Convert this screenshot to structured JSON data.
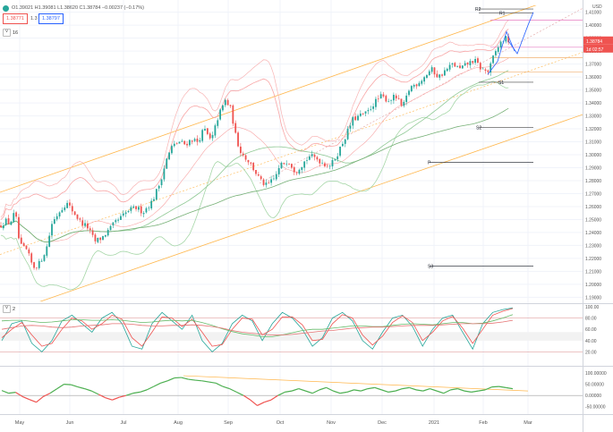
{
  "header": {
    "ohlc": "O1.39021 H1.39081 L1.38620 C1.38784 −0.00237 (−0.17%)",
    "sell_price": "1.38771",
    "lot_size": "1.3",
    "buy_price": "1.38797",
    "indicator_label": "16",
    "osc_label": "2"
  },
  "colors": {
    "up": "#26a69a",
    "down": "#ef5350",
    "bollinger": "#f8a5a5",
    "ma_fast": "#90c995",
    "ma_slow": "#76b076",
    "channel": "#ffb74d",
    "pitchfork": "#2962ff",
    "pivot": "#131722",
    "stoch_k": "#26a69a",
    "stoch_d": "#ef5350",
    "osc_line": "#4caf50",
    "osc_neg": "#ef5350"
  },
  "chart_data": [
    {
      "type": "candlestick",
      "title": "",
      "ylabel": "USD",
      "x_tick_labels": [
        "May",
        "Jun",
        "Jul",
        "Aug",
        "Sep",
        "Oct",
        "Nov",
        "Dec",
        "2021",
        "Feb",
        "Mar"
      ],
      "ylim": [
        1.1868,
        1.4153
      ],
      "y_tick_labels": [
        "1.41000",
        "1.40000",
        "1.39000",
        "1.38000",
        "1.37000",
        "1.36000",
        "1.35000",
        "1.34000",
        "1.33000",
        "1.32000",
        "1.31000",
        "1.30000",
        "1.29000",
        "1.28000",
        "1.27000",
        "1.26000",
        "1.25000",
        "1.24000",
        "1.23000",
        "1.22000",
        "1.21000",
        "1.20000",
        "1.19000"
      ],
      "close_path": [
        [
          0,
          1.245
        ],
        [
          6,
          1.249
        ],
        [
          11,
          1.247
        ],
        [
          17,
          1.256
        ],
        [
          22,
          1.23
        ],
        [
          30,
          1.226
        ],
        [
          37,
          1.213
        ],
        [
          44,
          1.216
        ],
        [
          52,
          1.228
        ],
        [
          58,
          1.247
        ],
        [
          66,
          1.256
        ],
        [
          74,
          1.263
        ],
        [
          82,
          1.256
        ],
        [
          90,
          1.248
        ],
        [
          98,
          1.244
        ],
        [
          106,
          1.233
        ],
        [
          114,
          1.236
        ],
        [
          122,
          1.242
        ],
        [
          128,
          1.247
        ],
        [
          136,
          1.252
        ],
        [
          144,
          1.257
        ],
        [
          152,
          1.259
        ],
        [
          160,
          1.256
        ],
        [
          170,
          1.264
        ],
        [
          178,
          1.277
        ],
        [
          186,
          1.296
        ],
        [
          192,
          1.306
        ],
        [
          200,
          1.31
        ],
        [
          207,
          1.308
        ],
        [
          214,
          1.312
        ],
        [
          221,
          1.31
        ],
        [
          228,
          1.32
        ],
        [
          236,
          1.31
        ],
        [
          244,
          1.33
        ],
        [
          252,
          1.342
        ],
        [
          258,
          1.335
        ],
        [
          264,
          1.312
        ],
        [
          270,
          1.301
        ],
        [
          278,
          1.295
        ],
        [
          286,
          1.286
        ],
        [
          292,
          1.279
        ],
        [
          298,
          1.276
        ],
        [
          306,
          1.281
        ],
        [
          314,
          1.292
        ],
        [
          322,
          1.296
        ],
        [
          330,
          1.287
        ],
        [
          338,
          1.293
        ],
        [
          346,
          1.299
        ],
        [
          354,
          1.297
        ],
        [
          362,
          1.293
        ],
        [
          370,
          1.292
        ],
        [
          378,
          1.302
        ],
        [
          386,
          1.314
        ],
        [
          394,
          1.327
        ],
        [
          402,
          1.33
        ],
        [
          410,
          1.332
        ],
        [
          418,
          1.34
        ],
        [
          426,
          1.345
        ],
        [
          434,
          1.342
        ],
        [
          442,
          1.345
        ],
        [
          450,
          1.336
        ],
        [
          458,
          1.352
        ],
        [
          466,
          1.355
        ],
        [
          474,
          1.36
        ],
        [
          482,
          1.366
        ],
        [
          490,
          1.36
        ],
        [
          498,
          1.365
        ],
        [
          506,
          1.37
        ],
        [
          514,
          1.366
        ],
        [
          522,
          1.37
        ],
        [
          530,
          1.373
        ],
        [
          538,
          1.366
        ],
        [
          546,
          1.364
        ],
        [
          552,
          1.377
        ],
        [
          558,
          1.385
        ],
        [
          564,
          1.39
        ],
        [
          568,
          1.388
        ],
        [
          571,
          1.3878
        ]
      ],
      "levels": [
        {
          "name": "R2",
          "value": 1.4125
        },
        {
          "name": "R1",
          "value": 1.4095
        },
        {
          "name": "",
          "value": 1.404
        },
        {
          "name": "",
          "value": 1.383
        },
        {
          "name": "",
          "value": 1.375
        },
        {
          "name": "",
          "value": 1.364
        },
        {
          "name": "S1",
          "value": 1.356
        },
        {
          "name": "S2",
          "value": 1.321
        },
        {
          "name": "P",
          "value": 1.294
        },
        {
          "name": "S3",
          "value": 1.214
        }
      ],
      "price_label_buy": "1.38784",
      "price_label_countdown": "1d 02:57"
    },
    {
      "type": "line",
      "title": "",
      "ylim": [
        0,
        100
      ],
      "y_tick_labels": [
        "100.00",
        "80.00",
        "60.00",
        "40.00",
        "20.00"
      ],
      "bands": [
        55,
        40
      ],
      "series": [
        {
          "name": "",
          "role": "k",
          "values": [
            40,
            70,
            75,
            35,
            20,
            40,
            75,
            85,
            70,
            55,
            80,
            90,
            70,
            30,
            25,
            70,
            90,
            75,
            60,
            85,
            40,
            20,
            35,
            70,
            85,
            75,
            40,
            70,
            90,
            80,
            60,
            30,
            45,
            80,
            90,
            75,
            40,
            25,
            55,
            80,
            85,
            65,
            30,
            60,
            80,
            85,
            55,
            25,
            70,
            90,
            95,
            98
          ]
        },
        {
          "name": "",
          "role": "d",
          "values": [
            45,
            60,
            72,
            50,
            30,
            35,
            60,
            80,
            75,
            60,
            70,
            85,
            78,
            45,
            30,
            55,
            82,
            80,
            65,
            78,
            55,
            30,
            33,
            60,
            80,
            78,
            50,
            60,
            82,
            82,
            68,
            40,
            42,
            70,
            86,
            80,
            50,
            32,
            48,
            72,
            84,
            72,
            40,
            55,
            75,
            83,
            62,
            35,
            60,
            85,
            92,
            97
          ]
        },
        {
          "name": "",
          "role": "k_slow",
          "values": [
            75,
            76,
            76,
            74,
            72,
            73,
            75,
            77,
            77,
            76,
            76,
            77,
            76,
            74,
            72,
            73,
            75,
            76,
            75,
            76,
            72,
            67,
            61,
            56,
            52,
            50,
            47,
            47,
            50,
            54,
            58,
            60,
            60,
            62,
            64,
            66,
            66,
            65,
            65,
            67,
            69,
            70,
            69,
            68,
            70,
            72,
            72,
            70,
            71,
            75,
            80,
            86
          ]
        },
        {
          "name": "",
          "role": "d_slow",
          "values": [
            60,
            63,
            66,
            67,
            66,
            64,
            63,
            64,
            66,
            67,
            68,
            70,
            70,
            69,
            67,
            66,
            66,
            67,
            67,
            68,
            67,
            65,
            62,
            58,
            55,
            53,
            51,
            50,
            50,
            51,
            53,
            55,
            57,
            58,
            60,
            62,
            63,
            64,
            64,
            65,
            66,
            67,
            67,
            67,
            68,
            69,
            70,
            70,
            70,
            71,
            73,
            76
          ]
        }
      ]
    },
    {
      "type": "line",
      "title": "",
      "ylim": [
        -75,
        120
      ],
      "y_tick_labels": [
        "100.00000",
        "50.00000",
        "0.00000",
        "-50.00000"
      ],
      "series": [
        {
          "name": "",
          "values": [
            22,
            10,
            14,
            -5,
            -18,
            -30,
            -5,
            10,
            30,
            50,
            48,
            38,
            30,
            20,
            5,
            -10,
            -20,
            -8,
            0,
            10,
            15,
            25,
            40,
            55,
            65,
            78,
            80,
            72,
            68,
            65,
            60,
            55,
            40,
            30,
            15,
            0,
            -20,
            -45,
            -30,
            -20,
            0,
            15,
            20,
            30,
            20,
            10,
            25,
            35,
            20,
            10,
            15,
            25,
            20,
            30,
            35,
            25,
            15,
            20,
            30,
            35,
            25,
            20,
            30,
            20,
            10,
            25,
            30,
            20,
            15,
            20,
            25,
            38,
            40,
            35,
            30
          ]
        }
      ]
    }
  ]
}
